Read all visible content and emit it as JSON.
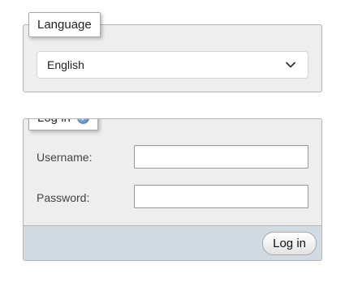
{
  "language": {
    "legend": "Language",
    "selected": "English",
    "dropdown_icon": "chevron-down-icon"
  },
  "login": {
    "legend": "Log in",
    "help_icon": "help-icon",
    "help_glyph": "?",
    "username_label": "Username:",
    "username_value": "",
    "password_label": "Password:",
    "password_value": "",
    "submit_label": "Log in"
  },
  "colors": {
    "panel_bg": "#eeeeee",
    "footer_bg": "#d3dbe2",
    "help_icon_blue": "#6f9fd3"
  }
}
